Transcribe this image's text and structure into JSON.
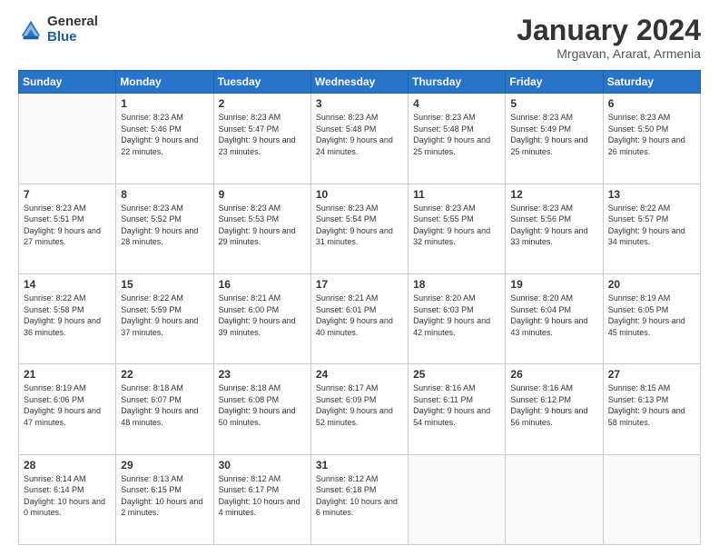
{
  "logo": {
    "general": "General",
    "blue": "Blue"
  },
  "header": {
    "month": "January 2024",
    "location": "Mrgavan, Ararat, Armenia"
  },
  "weekdays": [
    "Sunday",
    "Monday",
    "Tuesday",
    "Wednesday",
    "Thursday",
    "Friday",
    "Saturday"
  ],
  "weeks": [
    [
      {
        "day": "",
        "sunrise": "",
        "sunset": "",
        "daylight": ""
      },
      {
        "day": "1",
        "sunrise": "Sunrise: 8:23 AM",
        "sunset": "Sunset: 5:46 PM",
        "daylight": "Daylight: 9 hours and 22 minutes."
      },
      {
        "day": "2",
        "sunrise": "Sunrise: 8:23 AM",
        "sunset": "Sunset: 5:47 PM",
        "daylight": "Daylight: 9 hours and 23 minutes."
      },
      {
        "day": "3",
        "sunrise": "Sunrise: 8:23 AM",
        "sunset": "Sunset: 5:48 PM",
        "daylight": "Daylight: 9 hours and 24 minutes."
      },
      {
        "day": "4",
        "sunrise": "Sunrise: 8:23 AM",
        "sunset": "Sunset: 5:48 PM",
        "daylight": "Daylight: 9 hours and 25 minutes."
      },
      {
        "day": "5",
        "sunrise": "Sunrise: 8:23 AM",
        "sunset": "Sunset: 5:49 PM",
        "daylight": "Daylight: 9 hours and 25 minutes."
      },
      {
        "day": "6",
        "sunrise": "Sunrise: 8:23 AM",
        "sunset": "Sunset: 5:50 PM",
        "daylight": "Daylight: 9 hours and 26 minutes."
      }
    ],
    [
      {
        "day": "7",
        "sunrise": "Sunrise: 8:23 AM",
        "sunset": "Sunset: 5:51 PM",
        "daylight": "Daylight: 9 hours and 27 minutes."
      },
      {
        "day": "8",
        "sunrise": "Sunrise: 8:23 AM",
        "sunset": "Sunset: 5:52 PM",
        "daylight": "Daylight: 9 hours and 28 minutes."
      },
      {
        "day": "9",
        "sunrise": "Sunrise: 8:23 AM",
        "sunset": "Sunset: 5:53 PM",
        "daylight": "Daylight: 9 hours and 29 minutes."
      },
      {
        "day": "10",
        "sunrise": "Sunrise: 8:23 AM",
        "sunset": "Sunset: 5:54 PM",
        "daylight": "Daylight: 9 hours and 31 minutes."
      },
      {
        "day": "11",
        "sunrise": "Sunrise: 8:23 AM",
        "sunset": "Sunset: 5:55 PM",
        "daylight": "Daylight: 9 hours and 32 minutes."
      },
      {
        "day": "12",
        "sunrise": "Sunrise: 8:23 AM",
        "sunset": "Sunset: 5:56 PM",
        "daylight": "Daylight: 9 hours and 33 minutes."
      },
      {
        "day": "13",
        "sunrise": "Sunrise: 8:22 AM",
        "sunset": "Sunset: 5:57 PM",
        "daylight": "Daylight: 9 hours and 34 minutes."
      }
    ],
    [
      {
        "day": "14",
        "sunrise": "Sunrise: 8:22 AM",
        "sunset": "Sunset: 5:58 PM",
        "daylight": "Daylight: 9 hours and 36 minutes."
      },
      {
        "day": "15",
        "sunrise": "Sunrise: 8:22 AM",
        "sunset": "Sunset: 5:59 PM",
        "daylight": "Daylight: 9 hours and 37 minutes."
      },
      {
        "day": "16",
        "sunrise": "Sunrise: 8:21 AM",
        "sunset": "Sunset: 6:00 PM",
        "daylight": "Daylight: 9 hours and 39 minutes."
      },
      {
        "day": "17",
        "sunrise": "Sunrise: 8:21 AM",
        "sunset": "Sunset: 6:01 PM",
        "daylight": "Daylight: 9 hours and 40 minutes."
      },
      {
        "day": "18",
        "sunrise": "Sunrise: 8:20 AM",
        "sunset": "Sunset: 6:03 PM",
        "daylight": "Daylight: 9 hours and 42 minutes."
      },
      {
        "day": "19",
        "sunrise": "Sunrise: 8:20 AM",
        "sunset": "Sunset: 6:04 PM",
        "daylight": "Daylight: 9 hours and 43 minutes."
      },
      {
        "day": "20",
        "sunrise": "Sunrise: 8:19 AM",
        "sunset": "Sunset: 6:05 PM",
        "daylight": "Daylight: 9 hours and 45 minutes."
      }
    ],
    [
      {
        "day": "21",
        "sunrise": "Sunrise: 8:19 AM",
        "sunset": "Sunset: 6:06 PM",
        "daylight": "Daylight: 9 hours and 47 minutes."
      },
      {
        "day": "22",
        "sunrise": "Sunrise: 8:18 AM",
        "sunset": "Sunset: 6:07 PM",
        "daylight": "Daylight: 9 hours and 48 minutes."
      },
      {
        "day": "23",
        "sunrise": "Sunrise: 8:18 AM",
        "sunset": "Sunset: 6:08 PM",
        "daylight": "Daylight: 9 hours and 50 minutes."
      },
      {
        "day": "24",
        "sunrise": "Sunrise: 8:17 AM",
        "sunset": "Sunset: 6:09 PM",
        "daylight": "Daylight: 9 hours and 52 minutes."
      },
      {
        "day": "25",
        "sunrise": "Sunrise: 8:16 AM",
        "sunset": "Sunset: 6:11 PM",
        "daylight": "Daylight: 9 hours and 54 minutes."
      },
      {
        "day": "26",
        "sunrise": "Sunrise: 8:16 AM",
        "sunset": "Sunset: 6:12 PM",
        "daylight": "Daylight: 9 hours and 56 minutes."
      },
      {
        "day": "27",
        "sunrise": "Sunrise: 8:15 AM",
        "sunset": "Sunset: 6:13 PM",
        "daylight": "Daylight: 9 hours and 58 minutes."
      }
    ],
    [
      {
        "day": "28",
        "sunrise": "Sunrise: 8:14 AM",
        "sunset": "Sunset: 6:14 PM",
        "daylight": "Daylight: 10 hours and 0 minutes."
      },
      {
        "day": "29",
        "sunrise": "Sunrise: 8:13 AM",
        "sunset": "Sunset: 6:15 PM",
        "daylight": "Daylight: 10 hours and 2 minutes."
      },
      {
        "day": "30",
        "sunrise": "Sunrise: 8:12 AM",
        "sunset": "Sunset: 6:17 PM",
        "daylight": "Daylight: 10 hours and 4 minutes."
      },
      {
        "day": "31",
        "sunrise": "Sunrise: 8:12 AM",
        "sunset": "Sunset: 6:18 PM",
        "daylight": "Daylight: 10 hours and 6 minutes."
      },
      {
        "day": "",
        "sunrise": "",
        "sunset": "",
        "daylight": ""
      },
      {
        "day": "",
        "sunrise": "",
        "sunset": "",
        "daylight": ""
      },
      {
        "day": "",
        "sunrise": "",
        "sunset": "",
        "daylight": ""
      }
    ]
  ]
}
